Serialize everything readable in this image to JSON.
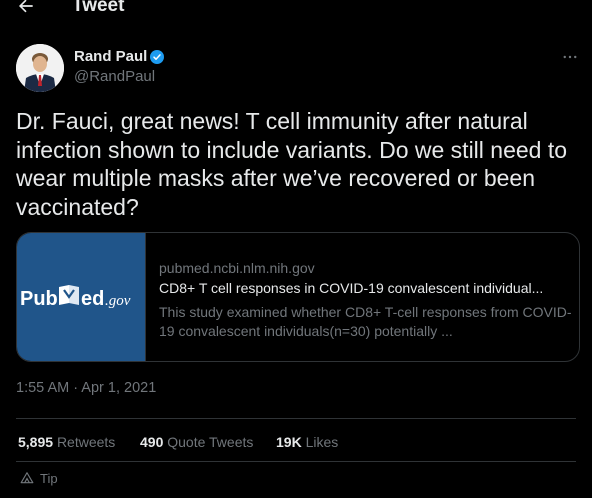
{
  "header": {
    "title": "Tweet"
  },
  "author": {
    "name": "Rand Paul",
    "handle": "@RandPaul"
  },
  "tweet": {
    "text": "Dr. Fauci, great news! T cell immunity after natural infection shown to include variants. Do we still need to wear multiple masks after we’ve recovered or been vaccinated?"
  },
  "card": {
    "logo_text_left": "Pub",
    "logo_text_right": "ed",
    "logo_suffix": ".gov",
    "domain": "pubmed.ncbi.nlm.nih.gov",
    "title": "CD8+ T cell responses in COVID-19 convalescent individual...",
    "description": "This study examined whether CD8+ T-cell responses from COVID-19 convalescent individuals(n=30) potentially ..."
  },
  "timestamp": "1:55 AM · Apr 1, 2021",
  "stats": {
    "retweets_count": "5,895",
    "retweets_label": "Retweets",
    "quotes_count": "490",
    "quotes_label": "Quote Tweets",
    "likes_count": "19K",
    "likes_label": "Likes"
  },
  "tip": {
    "label": "Tip"
  },
  "colors": {
    "background": "#000000",
    "text": "#e7e9ea",
    "secondary": "#71767b",
    "border": "#2f3336",
    "verified": "#1d9bf0",
    "pubmed_blue": "#20558a"
  },
  "icons": {
    "back": "arrow-left-icon",
    "verified": "verified-badge-icon",
    "more": "more-horizontal-icon",
    "tip": "tip-icon"
  }
}
